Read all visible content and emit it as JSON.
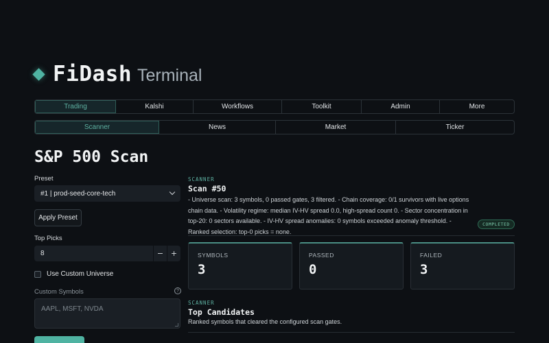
{
  "brand": {
    "name": "FiDash",
    "subtitle": "Terminal"
  },
  "primary_tabs": [
    {
      "label": "Trading",
      "active": true
    },
    {
      "label": "Kalshi",
      "active": false
    },
    {
      "label": "Workflows",
      "active": false
    },
    {
      "label": "Toolkit",
      "active": false
    },
    {
      "label": "Admin",
      "active": false
    },
    {
      "label": "More",
      "active": false
    }
  ],
  "secondary_tabs": [
    {
      "label": "Scanner",
      "active": true
    },
    {
      "label": "News",
      "active": false
    },
    {
      "label": "Market",
      "active": false
    },
    {
      "label": "Ticker",
      "active": false
    }
  ],
  "page_title": "S&P 500 Scan",
  "form": {
    "preset_label": "Preset",
    "preset_value": "#1 | prod-seed-core-tech",
    "apply_preset_label": "Apply Preset",
    "top_picks_label": "Top Picks",
    "top_picks_value": "8",
    "decrement": "−",
    "increment": "+",
    "custom_universe_label": "Use Custom Universe",
    "custom_universe_checked": false,
    "custom_symbols_label": "Custom Symbols",
    "custom_symbols_placeholder": "AAPL, MSFT, NVDA",
    "help_glyph": "?"
  },
  "scan": {
    "tag": "SCANNER",
    "title": "Scan #50",
    "summary": "- Universe scan: 3 symbols, 0 passed gates, 3 filtered. - Chain coverage: 0/1 survivors with live options chain data. - Volatility regime: median IV-HV spread 0.0, high-spread count 0. - Sector concentration in top-20: 0 sectors available. - IV-HV spread anomalies: 0 symbols exceeded anomaly threshold. - Ranked selection: top-0 picks = none.",
    "status": "COMPLETED",
    "stats": [
      {
        "label": "SYMBOLS",
        "value": "3"
      },
      {
        "label": "PASSED",
        "value": "0"
      },
      {
        "label": "FAILED",
        "value": "3"
      }
    ]
  },
  "candidates": {
    "tag": "SCANNER",
    "title": "Top Candidates",
    "subtitle": "Ranked symbols that cleared the configured scan gates."
  },
  "colors": {
    "accent": "#4fb3a2",
    "background": "#0d1014",
    "status_green": "#7fd0b0"
  },
  "icons": {
    "brand": "diamond-icon",
    "select": "chevron-down-icon",
    "help": "help-circle-icon"
  }
}
